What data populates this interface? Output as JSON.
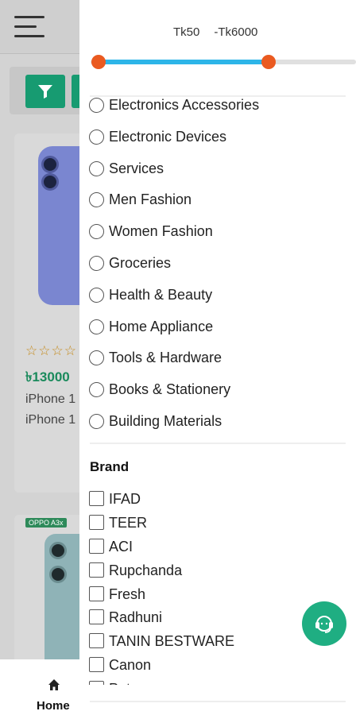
{
  "background": {
    "product1": {
      "price": "৳13000",
      "title_line1": "iPhone 1",
      "title_line2": "iPhone 1",
      "rating_stars": "☆☆☆☆"
    },
    "product2": {
      "tag": "OPPO A3x"
    },
    "bottom_nav": {
      "home_label": "Home",
      "home_icon": "home-icon"
    }
  },
  "filter_drawer": {
    "price_range": {
      "min_label": "Tk50",
      "max_label": "-Tk6000",
      "min_value": 50,
      "max_value": 6000,
      "min_fraction": 0.03,
      "max_fraction": 0.67,
      "accent_color": "#2db5e8",
      "thumb_color": "#ea5a20"
    },
    "categories": [
      "Electronics Accessories",
      "Electronic Devices",
      "Services",
      "Men Fashion",
      "Women Fashion",
      "Groceries",
      "Health & Beauty",
      "Home Appliance",
      "Tools & Hardware",
      "Books & Stationery",
      "Building Materials"
    ],
    "brand": {
      "title": "Brand",
      "items": [
        "IFAD",
        "TEER",
        "ACI",
        "Rupchanda",
        "Fresh",
        "Radhuni",
        "TANIN BESTWARE",
        "Canon",
        "Pet..."
      ]
    }
  },
  "support_button": {
    "icon": "headset-icon",
    "color": "#1fae82"
  }
}
